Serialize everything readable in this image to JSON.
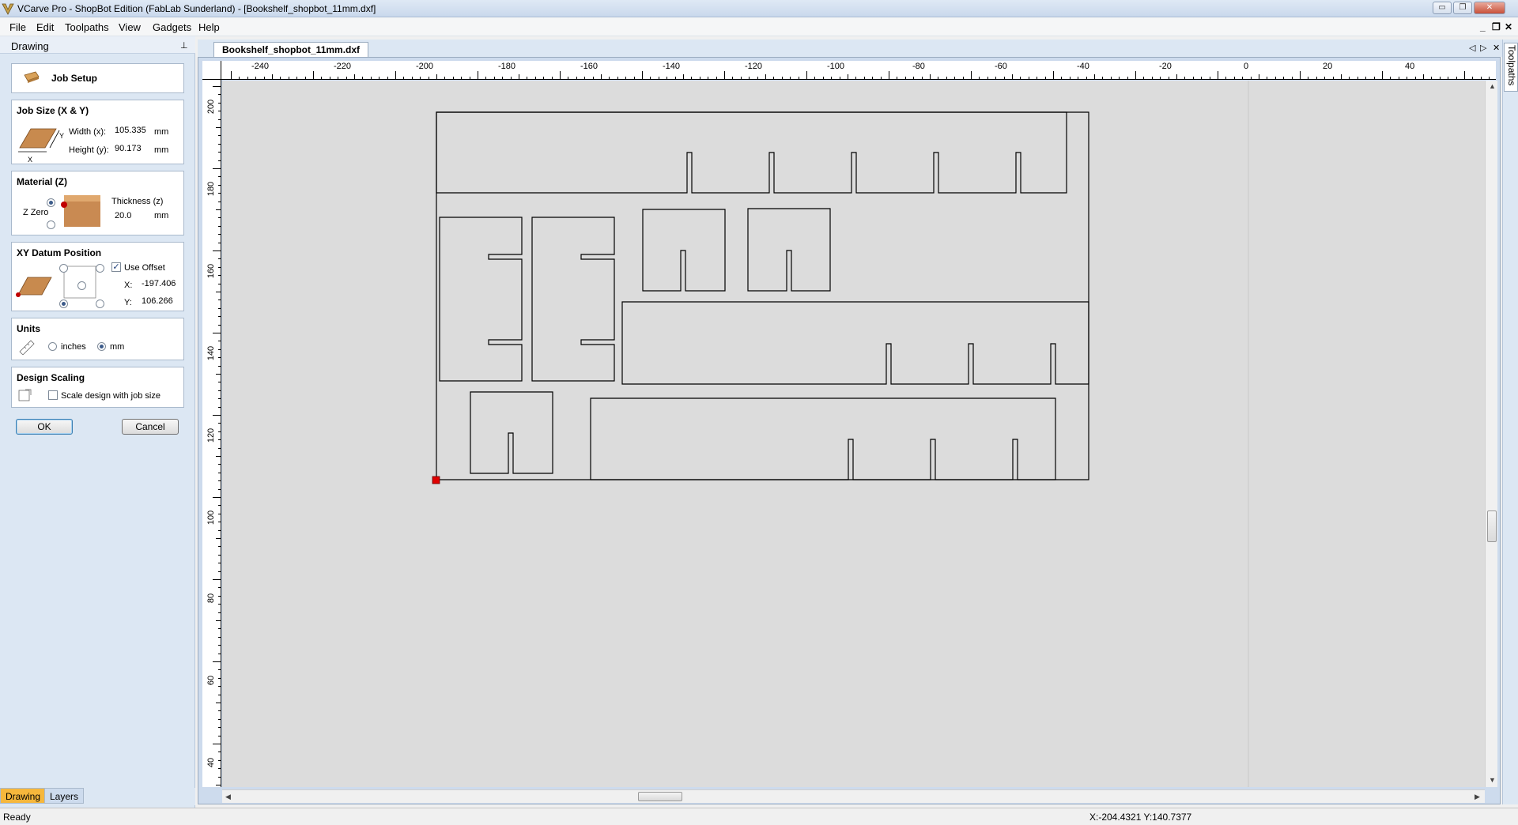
{
  "window": {
    "title": "VCarve Pro - ShopBot Edition (FabLab Sunderland) - [Bookshelf_shopbot_11mm.dxf]",
    "minimize_glyph": "▭",
    "restore_glyph": "❐",
    "close_glyph": "✕"
  },
  "menu": {
    "items": [
      "File",
      "Edit",
      "Toolpaths",
      "View",
      "Gadgets",
      "Help"
    ],
    "mdi_minimize": "_",
    "mdi_restore": "❐",
    "mdi_close": "✕"
  },
  "left_panel": {
    "title": "Drawing",
    "pin_glyph": "⊥",
    "job_setup": {
      "label": "Job Setup",
      "icon": "job-setup-icon"
    },
    "job_size": {
      "heading": "Job Size (X & Y)",
      "width_label": "Width (x):",
      "width_value": "105.335",
      "height_label": "Height (y):",
      "height_value": "90.173",
      "unit": "mm",
      "axis_x": "X",
      "axis_y": "Y"
    },
    "material": {
      "heading": "Material (Z)",
      "z_zero_label": "Z Zero",
      "thickness_label": "Thickness (z)",
      "thickness_value": "20.0",
      "unit": "mm"
    },
    "xy_datum": {
      "heading": "XY Datum Position",
      "use_offset_label": "Use Offset",
      "use_offset_checked": true,
      "x_label": "X:",
      "x_value": "-197.406",
      "y_label": "Y:",
      "y_value": "106.266"
    },
    "units": {
      "heading": "Units",
      "inches_label": "inches",
      "mm_label": "mm",
      "selected": "mm"
    },
    "design_scaling": {
      "heading": "Design Scaling",
      "scale_label": "Scale design with job size"
    },
    "ok_label": "OK",
    "cancel_label": "Cancel"
  },
  "bottom_tabs": [
    "Drawing",
    "Layers"
  ],
  "document_tab": {
    "label": "Bookshelf_shopbot_11mm.dxf",
    "prev_glyph": "◁",
    "next_glyph": "▷",
    "close_glyph": "✕"
  },
  "ruler": {
    "x_labels": [
      "-240",
      "-220",
      "-200",
      "-180",
      "-160",
      "-140",
      "-120",
      "-100",
      "-80",
      "-60",
      "-40",
      "-20",
      "0",
      "20",
      "40"
    ],
    "y_labels": [
      "200",
      "180",
      "160",
      "140",
      "120",
      "100",
      "80",
      "60",
      "40"
    ]
  },
  "right_tab": {
    "label": "Toolpaths"
  },
  "status": {
    "text": "Ready",
    "coords": "X:-204.4321 Y:140.7377"
  },
  "colors": {
    "panel_bg": "#dce7f3",
    "canvas_bg": "#dcdcdc",
    "origin_marker": "#e00000",
    "active_tab": "#f6b73c"
  }
}
